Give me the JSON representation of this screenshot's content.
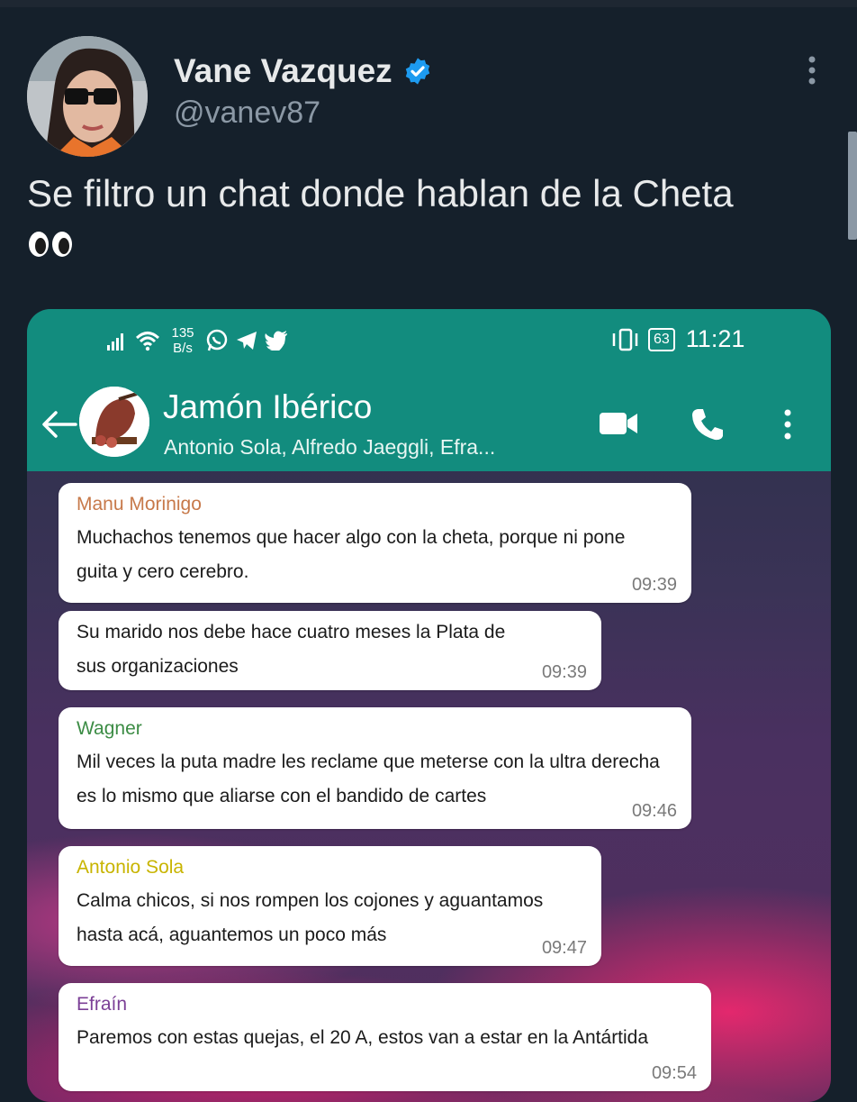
{
  "tweet": {
    "author_name": "Vane Vazquez",
    "handle": "@vanev87",
    "text": "Se filtro un chat donde hablan de la Cheta"
  },
  "whatsapp": {
    "status_bar": {
      "net_speed_value": "135",
      "net_speed_unit": "B/s",
      "battery": "63",
      "time": "11:21"
    },
    "group": {
      "name": "Jamón Ibérico",
      "members": "Antonio Sola, Alfredo Jaeggli, Efra..."
    },
    "messages": [
      {
        "sender": "Manu Morinigo",
        "sender_color": "#c7794a",
        "text": "Muchachos tenemos que hacer algo con la cheta, porque ni pone guita y cero cerebro.",
        "time": "09:39"
      },
      {
        "sender": "",
        "text": "Su marido nos debe hace cuatro meses la Plata de sus organizaciones",
        "time": "09:39"
      },
      {
        "sender": "Wagner",
        "sender_color": "#3c8c45",
        "text": "Mil veces la puta madre les reclame que meterse con la ultra derecha es lo mismo que aliarse con el bandido de cartes",
        "time": "09:46"
      },
      {
        "sender": "Antonio Sola",
        "sender_color": "#c8b400",
        "text": "Calma chicos, si nos rompen los cojones y aguantamos hasta acá, aguantemos un poco más",
        "time": "09:47"
      },
      {
        "sender": "Efraín",
        "sender_color": "#7b3f96",
        "text": "Paremos con estas quejas, el 20 A, estos van a estar en la Antártida",
        "time": "09:54"
      }
    ]
  },
  "colors": {
    "background": "#15202b",
    "whatsapp_green": "#128c7e",
    "verified_blue": "#1d9bf0"
  }
}
